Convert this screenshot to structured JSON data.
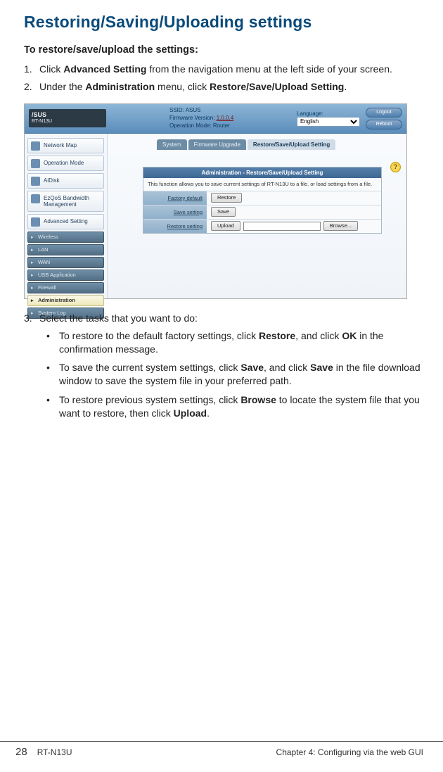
{
  "title": "Restoring/Saving/Uploading settings",
  "subheading": "To restore/save/upload the settings:",
  "steps": {
    "s1_a": "Click ",
    "s1_b": "Advanced Setting",
    "s1_c": " from the navigation menu at the left side of your screen.",
    "s2_a": "Under the ",
    "s2_b": "Administration",
    "s2_c": " menu, click ",
    "s2_d": "Restore/Save/Upload Setting",
    "s2_e": ".",
    "s3": "Select the tasks that you want to do:"
  },
  "bullets": {
    "b1_a": "To restore to the default factory settings, click ",
    "b1_b": "Restore",
    "b1_c": ", and click ",
    "b1_d": "OK",
    "b1_e": " in the confirmation message.",
    "b2_a": "To save the current system settings, click ",
    "b2_b": "Save",
    "b2_c": ", and click ",
    "b2_d": "Save",
    "b2_e": " in the file download window to save the system file in your preferred path.",
    "b3_a": "To restore previous system settings, click ",
    "b3_b": "Browse",
    "b3_c": " to locate the system file that you want to restore, then click ",
    "b3_d": "Upload",
    "b3_e": "."
  },
  "router": {
    "brand": "/SUS",
    "model": "RT-N13U",
    "ssid_label": "SSID:",
    "ssid_value": "ASUS",
    "fw_label": "Firmware Version:",
    "fw_value": "1.0.0.4",
    "opmode_label": "Operation Mode:",
    "opmode_value": "Router",
    "language_label": "Language:",
    "language_value": "English",
    "logout": "Logout",
    "reboot": "Reboot",
    "nav": [
      "Network Map",
      "Operation Mode",
      "AiDisk",
      "EzQoS Bandwidth Management",
      "Advanced Setting"
    ],
    "subnav": [
      "Wireless",
      "LAN",
      "WAN",
      "USB Application",
      "Firewall",
      "Administration",
      "System Log"
    ],
    "tabs": [
      "System",
      "Firmware Upgrade",
      "Restore/Save/Upload Setting"
    ],
    "panel_title": "Administration - Restore/Save/Upload Setting",
    "panel_desc": "This function allows you to save current settings of RT-N13U to a file, or load settings from a file.",
    "rows": {
      "factory_label": "Factory default",
      "factory_btn": "Restore",
      "save_label": "Save setting",
      "save_btn": "Save",
      "restore_label": "Restore setting",
      "restore_btn": "Upload",
      "browse_btn": "Browse..."
    },
    "help": "?"
  },
  "footer": {
    "page": "28",
    "model": "RT-N13U",
    "chapter": "Chapter 4: Configuring via the web GUI"
  }
}
